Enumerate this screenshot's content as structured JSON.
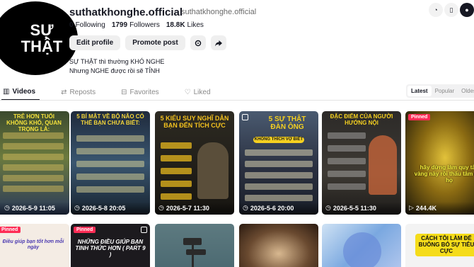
{
  "profile": {
    "avatar_line1": "SỰ",
    "avatar_line2": "THẬT",
    "username": "suthatkhonghe.official",
    "nickname": "suthatkhonghe.official",
    "following_count": "0",
    "following_label": "Following",
    "followers_count": "1799",
    "followers_label": "Followers",
    "likes_count": "18.8K",
    "likes_label": "Likes",
    "edit_label": "Edit profile",
    "promote_label": "Promote post",
    "bio_line1": "SỰ THẬT thì thường KHÓ NGHE",
    "bio_line2": "Nhưng NGHE được rồi sẽ TỈNH"
  },
  "tabs": {
    "videos": "Videos",
    "reposts": "Reposts",
    "favorites": "Favorites",
    "liked": "Liked"
  },
  "sort": {
    "latest": "Latest",
    "popular": "Popular",
    "oldest": "Oldest"
  },
  "videos": [
    {
      "date": "2026-5-9 11:05",
      "title": "TRẺ HƠN TUỔI KHÔNG KHÓ, QUAN TRỌNG LÀ:",
      "pinned": ""
    },
    {
      "date": "2026-5-8 20:05",
      "title": "5 BÍ MẬT VỀ BỘ NÃO CÓ THỂ BẠN CHƯA BIẾT:",
      "pinned": ""
    },
    {
      "date": "2026-5-7 11:30",
      "title": "5 KIỂU SUY NGHĨ DẪN BẠN ĐẾN TÍCH CỰC",
      "pinned": ""
    },
    {
      "date": "2026-5-6 20:00",
      "title": "5 SỰ THẬT ĐÀN ÔNG",
      "sub": "KHÔNG THÍCH VỢ BIẾT",
      "pinned": ""
    },
    {
      "date": "2026-5-5 11:30",
      "title": "ĐẶC ĐIỂM CỦA NGƯỜI HƯỚNG NỘI",
      "pinned": ""
    },
    {
      "date": "244.4K",
      "title": "hãy dừng làm quy tắc vàng này rồi thấu tâm cao họ",
      "pinned": "Pinned"
    }
  ],
  "row2": {
    "card1_pin": "Pinned",
    "card1_text": "Điều giúp bạn tốt hơn mỗi ngày",
    "card2_pin": "Pinned",
    "card2_text": "NHỮNG ĐIỀU GIÚP BẠN TINH THỨC HƠN ( PART 9 )",
    "card6_text": "CÁCH TÔI LÀM ĐỂ BUÔNG BỎ SỰ TIÊU CỰC"
  },
  "colors": {
    "accent": "#fe2c55",
    "pin": "#fe2c55"
  }
}
